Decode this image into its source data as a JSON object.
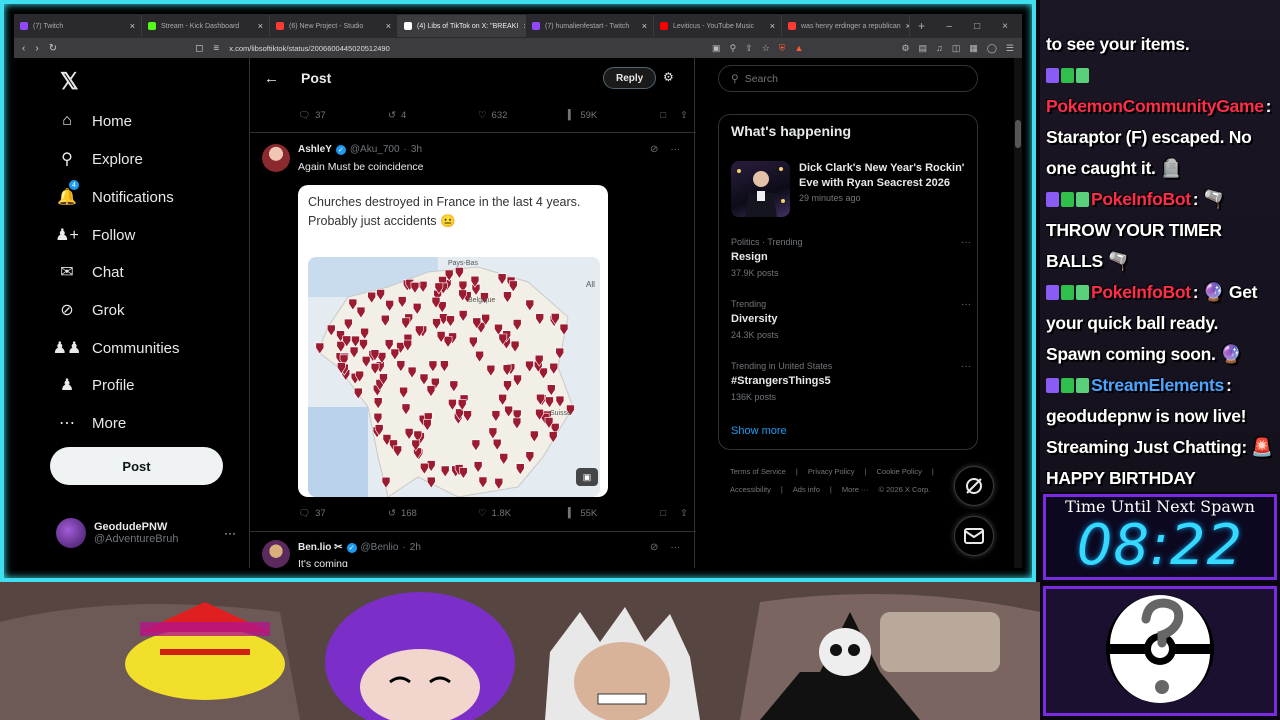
{
  "browser": {
    "tabs": [
      {
        "label": "(7) Twitch",
        "color": "#9146ff"
      },
      {
        "label": "Stream - Kick Dashboard",
        "color": "#53fc18"
      },
      {
        "label": "(6) New Project - Studio",
        "color": "#ff3b30"
      },
      {
        "label": "(4) Libs of TikTok on X: \"BREAKI",
        "color": "#ffffff"
      },
      {
        "label": "(7) humalienfestart - Twitch",
        "color": "#9146ff"
      },
      {
        "label": "Leviticus - YouTube Music",
        "color": "#ff0000"
      },
      {
        "label": "was henry erdinger a republican",
        "color": "#ff3b30"
      }
    ],
    "active_tab": 3,
    "url": "x.com/libsoftiktok/status/2006600445020512490"
  },
  "nav": {
    "items": [
      {
        "label": "Home",
        "icon": "home-icon"
      },
      {
        "label": "Explore",
        "icon": "search-icon"
      },
      {
        "label": "Notifications",
        "icon": "bell-icon",
        "badge": "4"
      },
      {
        "label": "Follow",
        "icon": "add-user-icon"
      },
      {
        "label": "Chat",
        "icon": "mail-icon"
      },
      {
        "label": "Grok",
        "icon": "grok-icon"
      },
      {
        "label": "Communities",
        "icon": "communities-icon"
      },
      {
        "label": "Profile",
        "icon": "profile-icon"
      },
      {
        "label": "More",
        "icon": "more-circle-icon"
      }
    ],
    "post_label": "Post",
    "profile": {
      "name": "GeodudePNW",
      "handle": "@AdventureBruh"
    }
  },
  "header": {
    "title": "Post",
    "reply_label": "Reply"
  },
  "top_actions": {
    "replies": "37",
    "reposts": "4",
    "likes": "632",
    "views": "59K"
  },
  "tweet": {
    "name": "AshleY",
    "handle": "@Aku_700",
    "time": "3h",
    "text": "Again Must be coincidence",
    "media_caption": "Churches destroyed in France in the last 4 years.\nProbably just accidents 😐",
    "map_labels": {
      "nl": "Pays-Bas",
      "be": "Belgique",
      "de": "All",
      "ch": "Suisse"
    },
    "replies": "37",
    "reposts": "168",
    "likes": "1.8K",
    "views": "55K"
  },
  "next_tweet": {
    "name": "Ben.lio ✂",
    "handle": "@Benlio",
    "time": "2h",
    "text": "It's coming"
  },
  "search": {
    "placeholder": "Search"
  },
  "happening": {
    "title": "What's happening",
    "event": {
      "title": "Dick Clark's New Year's Rockin' Eve with Ryan Seacrest 2026",
      "time": "29 minutes ago"
    },
    "trends": [
      {
        "context": "Politics · Trending",
        "name": "Resign",
        "count": "37.9K posts"
      },
      {
        "context": "Trending",
        "name": "Diversity",
        "count": "24.3K posts"
      },
      {
        "context": "Trending in United States",
        "name": "#StrangersThings5",
        "count": "136K posts"
      }
    ],
    "show_more": "Show more"
  },
  "footer": {
    "links": [
      "Terms of Service",
      "|",
      "Privacy Policy",
      "|",
      "Cookie Policy",
      "|"
    ],
    "links2": [
      "Accessibility",
      "|",
      "Ads info",
      "|",
      "More ···",
      "© 2026 X Corp."
    ]
  },
  "chat": {
    "messages": [
      {
        "user": "",
        "user_color": "",
        "text": "to see your items."
      },
      {
        "user": "PokemonCommunityGame",
        "user_color": "red",
        "text": ": Staraptor (F) escaped. No one caught it. 🪦"
      },
      {
        "user": "PokeInfoBot",
        "user_color": "red",
        "text": ": 🫗 THROW YOUR TIMER BALLS 🫗"
      },
      {
        "user": "PokeInfoBot",
        "user_color": "red",
        "text": ": 🔮 Get your quick ball ready. Spawn coming soon. 🔮"
      },
      {
        "user": "StreamElements",
        "user_color": "blue",
        "text": ": geodudepnw is now live! Streaming Just Chatting: 🚨 HAPPY BIRTHDAY HUMALIEN!!! 🚨"
      }
    ]
  },
  "timer": {
    "label": "Time Until Next Spawn",
    "value": "08:22"
  },
  "colors": {
    "accent": "#1d9bf0",
    "frame": "#3ee0f0",
    "timer": "#35d9ff",
    "overlay_border": "#7a2ae0",
    "pin": "#9b1b30"
  }
}
